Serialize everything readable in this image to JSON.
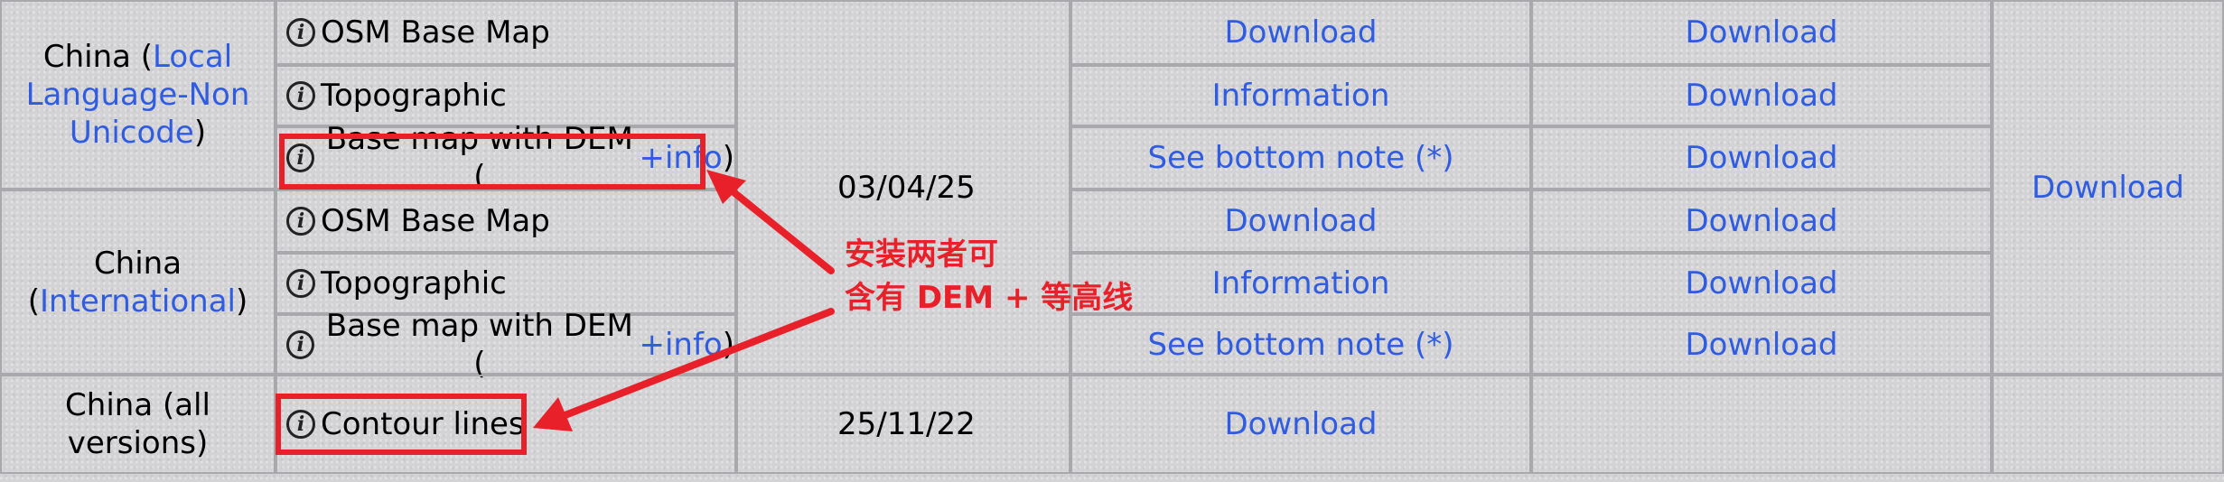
{
  "regions": {
    "china_local": {
      "prefix": "China (",
      "link": "Local Language-Non Unicode",
      "suffix": ")"
    },
    "china_international": {
      "prefix": "China (",
      "link": "International",
      "suffix": ")"
    },
    "china_all": "China (all versions)"
  },
  "maps": {
    "osm": "OSM Base Map",
    "topo": "Topographic",
    "dem_prefix": "Base map with DEM (",
    "dem_link": "+info",
    "dem_suffix": ")",
    "contour": "Contour lines"
  },
  "dates": {
    "group1": "03/04/25",
    "contour": "25/11/22"
  },
  "links": {
    "download": "Download",
    "information": "Information",
    "bottom_note": "See bottom note (*)"
  },
  "annotation": {
    "line1": "安装两者可",
    "line2": "含有 DEM + 等高线",
    "color": "#e8202a"
  },
  "colors": {
    "link": "#2f5ce0",
    "background": "#d3d3d6",
    "highlight": "#e8202a"
  },
  "icons": [
    "info-icon"
  ]
}
